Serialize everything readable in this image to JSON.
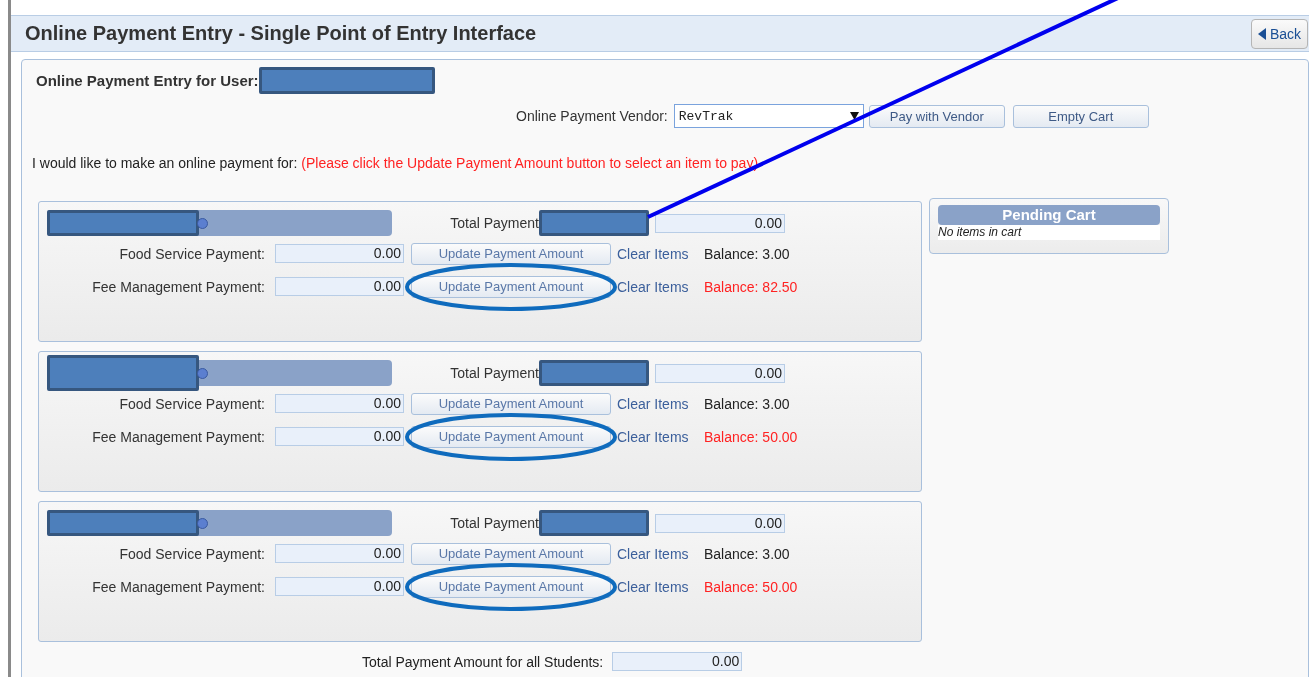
{
  "header": {
    "title": "Online Payment Entry - Single Point of Entry Interface",
    "back_button": "Back"
  },
  "user": {
    "label": "Online Payment Entry for User:",
    "redacted": true
  },
  "vendor": {
    "label": "Online Payment Vendor:",
    "value": "RevTrak",
    "buttons": [
      "Pay with Vendor",
      "Empty Cart"
    ]
  },
  "instructions": {
    "text": "I would like to make an online payment for:",
    "note": "(Please click the Update Payment Amount button to select an item to pay)"
  },
  "students": [
    {
      "name_redacted": true,
      "total_label": "Total Payment",
      "total_redacted": true,
      "total": "0.00",
      "rows": [
        {
          "label": "Food Service Payment:",
          "amount": "0.00",
          "button": "Update Payment Amount",
          "link": "Clear Items",
          "balance": "Balance: 3.00",
          "balance_alert": false,
          "circled": false
        },
        {
          "label": "Fee Management Payment:",
          "amount": "0.00",
          "button": "Update Payment Amount",
          "link": "Clear Items",
          "balance": "Balance: 82.50",
          "balance_alert": true,
          "circled": true
        }
      ]
    },
    {
      "name_redacted": true,
      "total_label": "Total Payment",
      "total_redacted": true,
      "total": "0.00",
      "rows": [
        {
          "label": "Food Service Payment:",
          "amount": "0.00",
          "button": "Update Payment Amount",
          "link": "Clear Items",
          "balance": "Balance: 3.00",
          "balance_alert": false,
          "circled": false
        },
        {
          "label": "Fee Management Payment:",
          "amount": "0.00",
          "button": "Update Payment Amount",
          "link": "Clear Items",
          "balance": "Balance: 50.00",
          "balance_alert": true,
          "circled": true
        }
      ]
    },
    {
      "name_redacted": true,
      "total_label": "Total Payment",
      "total_redacted": true,
      "total": "0.00",
      "rows": [
        {
          "label": "Food Service Payment:",
          "amount": "0.00",
          "button": "Update Payment Amount",
          "link": "Clear Items",
          "balance": "Balance: 3.00",
          "balance_alert": false,
          "circled": false
        },
        {
          "label": "Fee Management Payment:",
          "amount": "0.00",
          "button": "Update Payment Amount",
          "link": "Clear Items",
          "balance": "Balance: 50.00",
          "balance_alert": true,
          "circled": true
        }
      ]
    }
  ],
  "cart": {
    "title": "Pending Cart",
    "empty_text": "No items in cart"
  },
  "grand_total": {
    "label": "Total Payment Amount for all Students:",
    "value": "0.00"
  },
  "annotation_line": true
}
